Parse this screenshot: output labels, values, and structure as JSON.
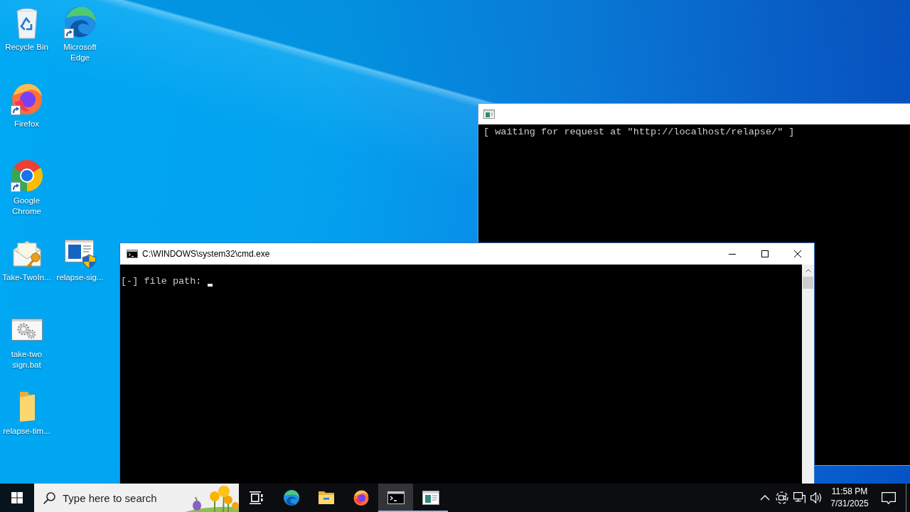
{
  "desktop": {
    "icons": [
      {
        "label": "Recycle Bin",
        "kind": "recycle",
        "shortcut": false
      },
      {
        "label": "Microsoft Edge",
        "kind": "edge",
        "shortcut": true
      },
      {
        "label": "Firefox",
        "kind": "firefox",
        "shortcut": true
      },
      {
        "label": "Google Chrome",
        "kind": "chrome",
        "shortcut": true
      },
      {
        "label": "Take-TwoIn...",
        "kind": "certificate",
        "shortcut": false
      },
      {
        "label": "relapse-sig...",
        "kind": "installer",
        "shortcut": false
      },
      {
        "label": "take-two sign.bat",
        "kind": "script",
        "shortcut": false
      },
      {
        "label": "relapse-tim...",
        "kind": "folder",
        "shortcut": false
      }
    ]
  },
  "windows": [
    {
      "kind": "console",
      "lines": [
        "[ waiting for request at \"http://localhost/relapse/\" ]"
      ]
    },
    {
      "kind": "cmd",
      "title": "C:\\WINDOWS\\system32\\cmd.exe",
      "prompt": "[-] file path:"
    }
  ],
  "taskbar": {
    "search": {
      "placeholder": "Type here to search"
    },
    "apps": [
      {
        "kind": "taskview",
        "running": false,
        "selected": false
      },
      {
        "kind": "edge",
        "running": false,
        "selected": false
      },
      {
        "kind": "explorer",
        "running": false,
        "selected": false
      },
      {
        "kind": "firefox",
        "running": false,
        "selected": false
      },
      {
        "kind": "cmd",
        "running": true,
        "selected": true
      },
      {
        "kind": "console",
        "running": true,
        "selected": false
      }
    ],
    "clock": {
      "time": "11:58 PM",
      "date": "7/31/2025"
    }
  }
}
